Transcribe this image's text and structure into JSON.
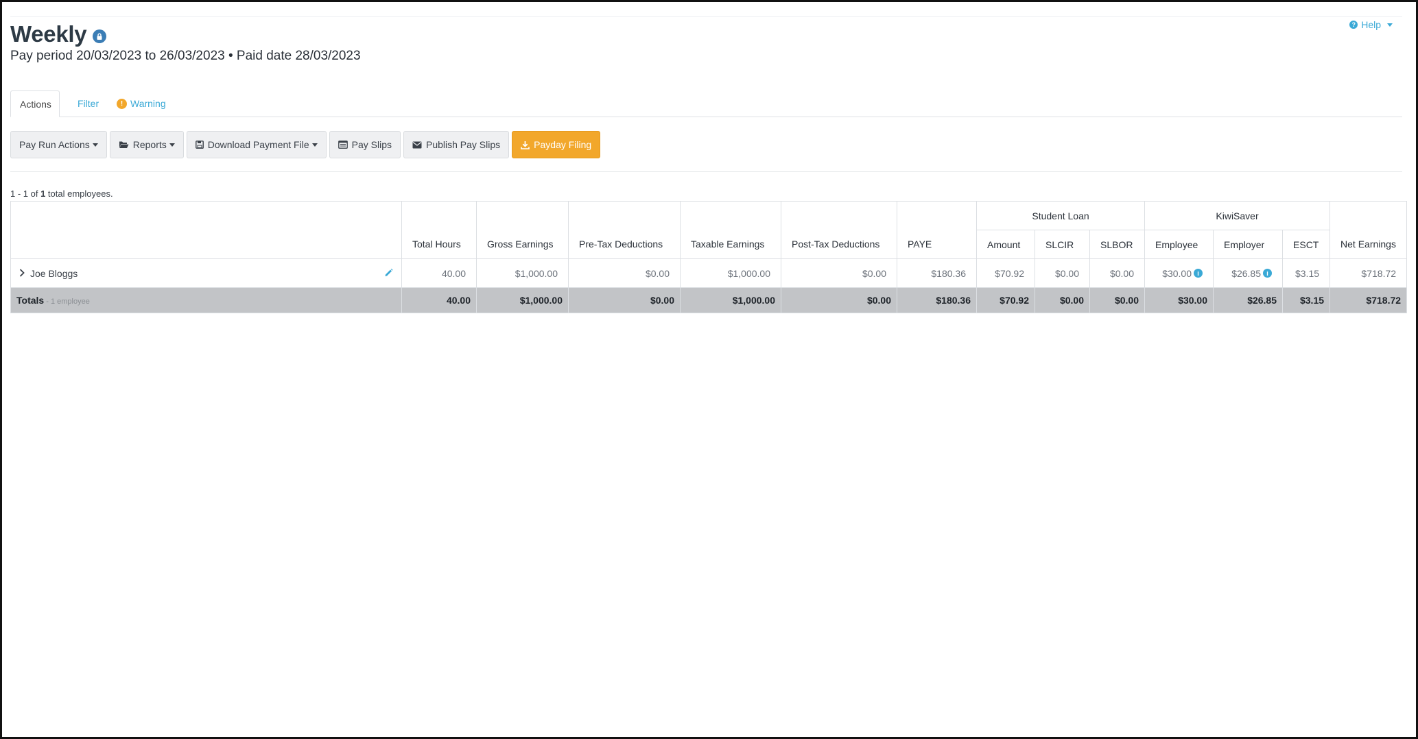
{
  "header": {
    "title": "Weekly",
    "subtitle": "Pay period 20/03/2023 to 26/03/2023 • Paid date 28/03/2023",
    "help_label": "Help"
  },
  "tabs": [
    {
      "label": "Actions",
      "active": true
    },
    {
      "label": "Filter",
      "active": false
    },
    {
      "label": "Warning",
      "active": false,
      "badge": "!"
    }
  ],
  "toolbar": {
    "pay_run_actions": "Pay Run Actions",
    "reports": "Reports",
    "download_payment_file": "Download Payment File",
    "pay_slips": "Pay Slips",
    "publish_pay_slips": "Publish Pay Slips",
    "payday_filing": "Payday Filing"
  },
  "count": {
    "prefix": "1 - 1 of ",
    "total": "1",
    "suffix": " total employees."
  },
  "table": {
    "group_headers": {
      "student_loan": "Student Loan",
      "kiwisaver": "KiwiSaver"
    },
    "columns": {
      "total_hours": "Total Hours",
      "gross_earnings": "Gross Earnings",
      "pre_tax_deductions": "Pre-Tax Deductions",
      "taxable_earnings": "Taxable Earnings",
      "post_tax_deductions": "Post-Tax Deductions",
      "paye": "PAYE",
      "amount": "Amount",
      "slcir": "SLCIR",
      "slbor": "SLBOR",
      "employee": "Employee",
      "employer": "Employer",
      "esct": "ESCT",
      "net_earnings": "Net Earnings"
    },
    "rows": [
      {
        "name": "Joe Bloggs",
        "total_hours": "40.00",
        "gross_earnings": "$1,000.00",
        "pre_tax_deductions": "$0.00",
        "taxable_earnings": "$1,000.00",
        "post_tax_deductions": "$0.00",
        "paye": "$180.36",
        "amount": "$70.92",
        "slcir": "$0.00",
        "slbor": "$0.00",
        "employee": "$30.00",
        "employer": "$26.85",
        "esct": "$3.15",
        "net_earnings": "$718.72"
      }
    ],
    "totals": {
      "label": "Totals",
      "sublabel": " - 1 employee",
      "total_hours": "40.00",
      "gross_earnings": "$1,000.00",
      "pre_tax_deductions": "$0.00",
      "taxable_earnings": "$1,000.00",
      "post_tax_deductions": "$0.00",
      "paye": "$180.36",
      "amount": "$70.92",
      "slcir": "$0.00",
      "slbor": "$0.00",
      "employee": "$30.00",
      "employer": "$26.85",
      "esct": "$3.15",
      "net_earnings": "$718.72"
    }
  },
  "colors": {
    "accent_link": "#3aa9d6",
    "primary_button": "#f2a72b",
    "lock_badge": "#3b7db5",
    "totals_row": "#c2c4c7"
  }
}
